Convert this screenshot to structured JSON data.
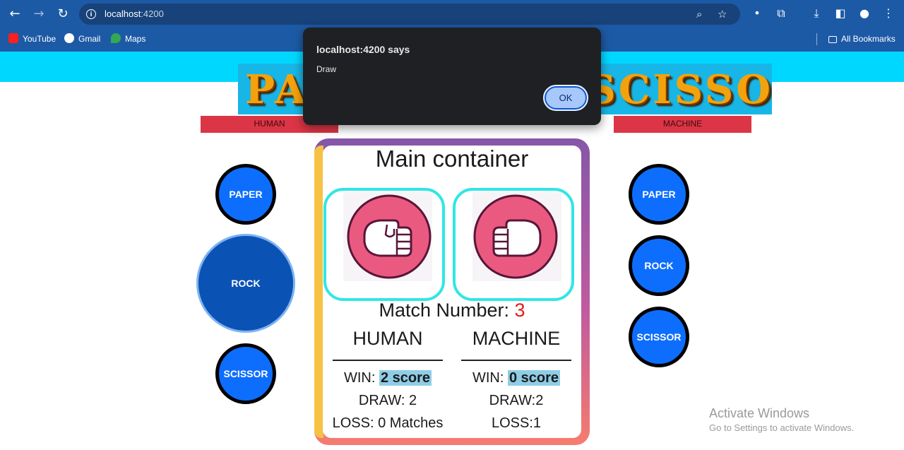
{
  "browser": {
    "url_host": "localhost",
    "url_port": ":4200",
    "bookmarks": [
      "YouTube",
      "Gmail",
      "Maps"
    ],
    "all_bookmarks": "All Bookmarks"
  },
  "dialog": {
    "title": "localhost:4200 says",
    "message": "Draw",
    "ok_label": "OK"
  },
  "page": {
    "title": "PAPER ROCK SCISSOR",
    "human_label": "HUMAN",
    "machine_label": "MACHINE",
    "human_choices": [
      "PAPER",
      "ROCK",
      "SCISSOR"
    ],
    "machine_choices": [
      "PAPER",
      "ROCK",
      "SCISSOR"
    ],
    "selected_human_choice": "ROCK"
  },
  "main_container": {
    "title": "Main container",
    "human_pick_icon": "rock-fist-icon",
    "machine_pick_icon": "rock-fist-icon",
    "match_label": "Match Number: ",
    "match_number": "3",
    "human": {
      "heading": "HUMAN",
      "win_label": "WIN: ",
      "win_value": "2 score",
      "draw": "DRAW: 2",
      "loss": "LOSS: 0 Matches"
    },
    "machine": {
      "heading": "MACHINE",
      "win_label": "WIN: ",
      "win_value": "0 score",
      "draw": "DRAW:2",
      "loss": "LOSS:1"
    }
  },
  "watermark": {
    "line1": "Activate Windows",
    "line2": "Go to Settings to activate Windows."
  },
  "colors": {
    "button_blue": "#0d6efd",
    "label_red": "#dc3545",
    "accent_cyan": "#00d7ff",
    "card_border": "#30e6e6",
    "match_number": "#e21b1b"
  }
}
